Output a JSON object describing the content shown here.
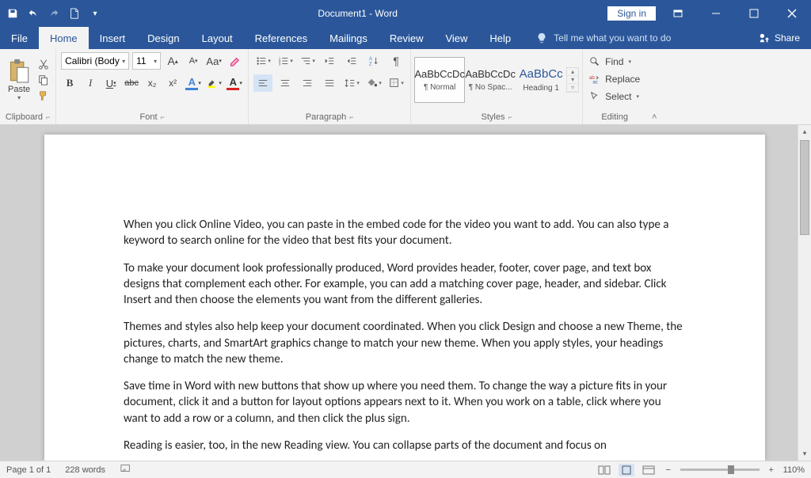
{
  "title": "Document1 - Word",
  "signin": "Sign in",
  "tabs": {
    "file": "File",
    "home": "Home",
    "insert": "Insert",
    "design": "Design",
    "layout": "Layout",
    "references": "References",
    "mailings": "Mailings",
    "review": "Review",
    "view": "View",
    "help": "Help"
  },
  "tellme": "Tell me what you want to do",
  "share": "Share",
  "ribbon": {
    "clipboard": {
      "label": "Clipboard",
      "paste": "Paste"
    },
    "font": {
      "label": "Font",
      "name": "Calibri (Body",
      "size": "11",
      "grow": "A",
      "shrink": "A",
      "case": "Aa",
      "bold": "B",
      "italic": "I",
      "underline": "U",
      "strike": "abc",
      "sub": "x₂",
      "sup": "x²",
      "texteff": "A",
      "highlight": "",
      "fontcolor": "A"
    },
    "paragraph": {
      "label": "Paragraph"
    },
    "styles": {
      "label": "Styles",
      "items": [
        {
          "preview": "AaBbCcDc",
          "name": "¶ Normal"
        },
        {
          "preview": "AaBbCcDc",
          "name": "¶ No Spac..."
        },
        {
          "preview": "AaBbCc",
          "name": "Heading 1"
        }
      ]
    },
    "editing": {
      "label": "Editing",
      "find": "Find",
      "replace": "Replace",
      "select": "Select"
    }
  },
  "document": {
    "p1": "When you click Online Video, you can paste in the embed code for the video you want to add. You can also type a keyword to search online for the video that best fits your document.",
    "p2": "To make your document look professionally produced, Word provides header, footer, cover page, and text box designs that complement each other. For example, you can add a matching cover page, header, and sidebar. Click Insert and then choose the elements you want from the different galleries.",
    "p3": "Themes and styles also help keep your document coordinated. When you click Design and choose a new Theme, the pictures, charts, and SmartArt graphics change to match your new theme. When you apply styles, your headings change to match the new theme.",
    "p4": "Save time in Word with new buttons that show up where you need them. To change the way a picture fits in your document, click it and a button for layout options appears next to it. When you work on a table, click where you want to add a row or a column, and then click the plus sign.",
    "p5": "Reading is easier, too, in the new Reading view. You can collapse parts of the document and focus on"
  },
  "status": {
    "page": "Page 1 of 1",
    "words": "228 words",
    "zoom": "110%"
  }
}
